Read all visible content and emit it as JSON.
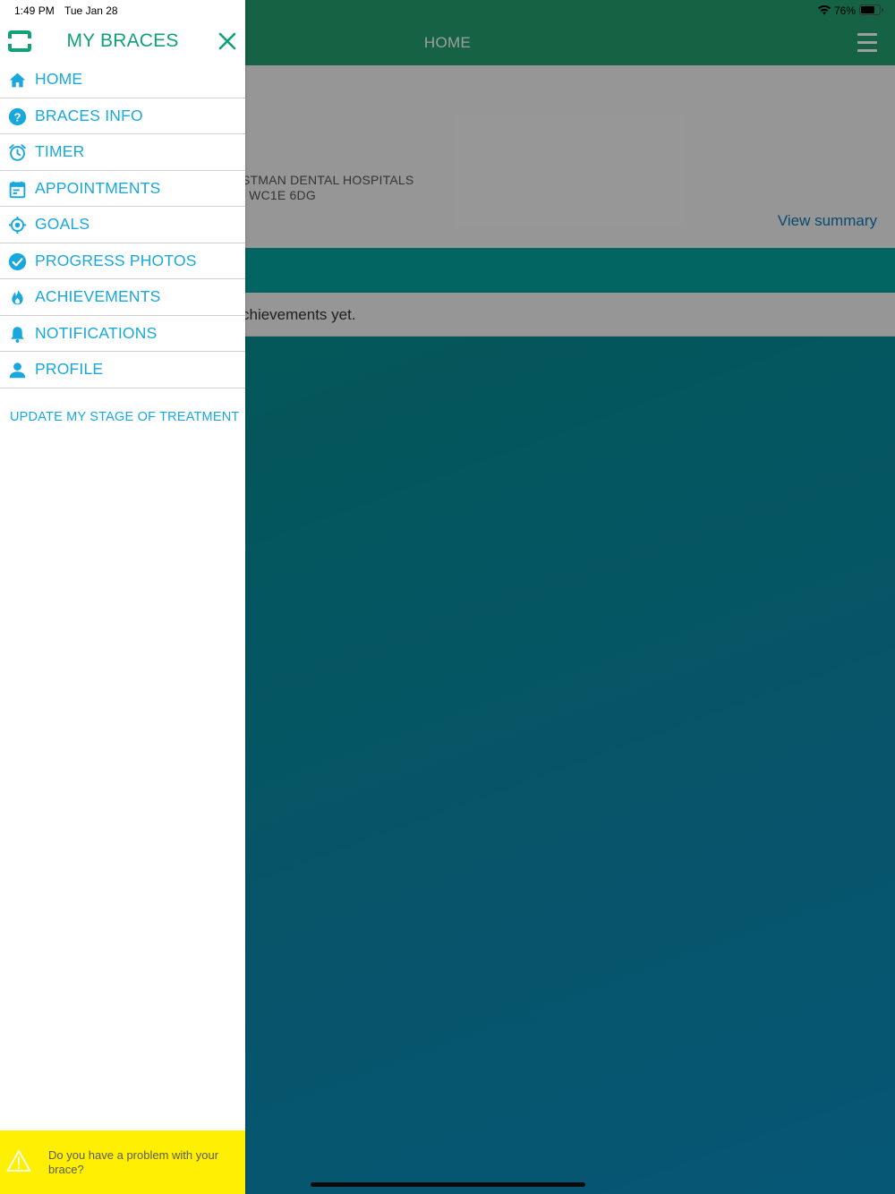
{
  "status_bar": {
    "time": "1:49 PM",
    "date": "Tue Jan 28",
    "battery_percent": "76%",
    "battery_level": 0.76
  },
  "main": {
    "header_title": "HOME",
    "hospital_text": "STMAN DENTAL HOSPITALS",
    "postcode_text": ", WC1E 6DG",
    "view_summary": "View summary",
    "achievements_text": "chievements yet."
  },
  "drawer": {
    "title": "MY BRACES",
    "menu": [
      {
        "label": "HOME",
        "icon": "home-icon"
      },
      {
        "label": "BRACES INFO",
        "icon": "question-icon"
      },
      {
        "label": "TIMER",
        "icon": "alarm-clock-icon"
      },
      {
        "label": "APPOINTMENTS",
        "icon": "calendar-icon"
      },
      {
        "label": "GOALS",
        "icon": "target-icon"
      },
      {
        "label": "PROGRESS PHOTOS",
        "icon": "check-circle-icon"
      },
      {
        "label": "ACHIEVEMENTS",
        "icon": "flame-icon"
      },
      {
        "label": "NOTIFICATIONS",
        "icon": "bell-icon"
      },
      {
        "label": "PROFILE",
        "icon": "person-icon"
      }
    ],
    "update_link": "UPDATE MY STAGE OF TREATMENT",
    "problem_banner": "Do you have a problem with your brace?"
  },
  "colors": {
    "accent_blue": "#18a8dd",
    "brand_green": "#11a07a",
    "header_green": "#229e6f",
    "warning_yellow": "#fff001"
  }
}
